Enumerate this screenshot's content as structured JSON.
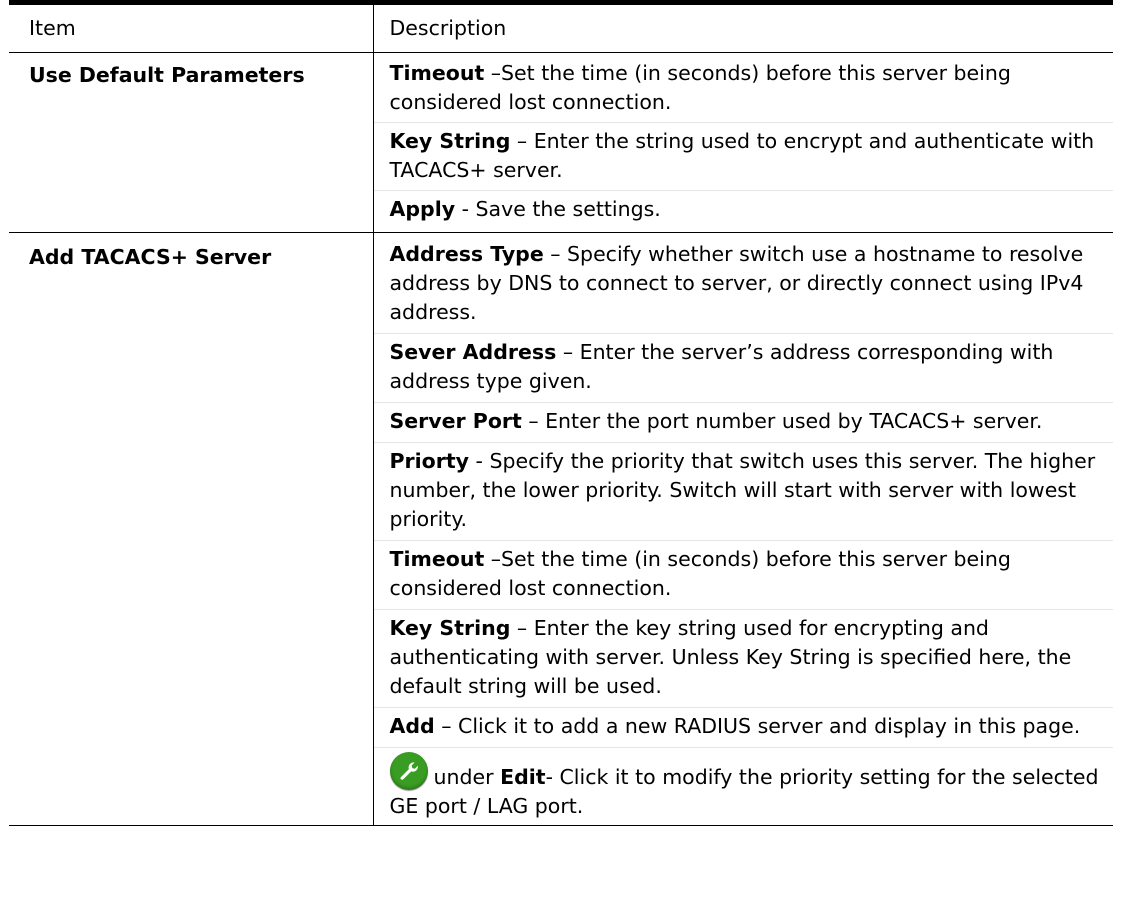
{
  "header": {
    "item": "Item",
    "description": "Description"
  },
  "rows": [
    {
      "item": "Use Default Parameters",
      "paras": [
        {
          "term": "Timeout",
          "text": " –Set the time (in seconds) before this server being considered lost connection."
        },
        {
          "term": "Key String",
          "text": " – Enter the string used to encrypt and authenticate with TACACS+ server."
        },
        {
          "term": "Apply",
          "text": " - Save the settings."
        }
      ]
    },
    {
      "item": "Add TACACS+ Server",
      "paras": [
        {
          "term": "Address Type",
          "text": " – Specify whether switch use a hostname to resolve address by DNS to connect to server, or directly connect using IPv4 address."
        },
        {
          "term": "Sever Address",
          "text": " – Enter the server’s address corresponding with address type given."
        },
        {
          "term": "Server Port",
          "text": " – Enter the port number used by TACACS+ server."
        },
        {
          "term": "Priorty",
          "text": " - Specify the priority that switch uses this server. The higher number, the lower priority. Switch will start with server with lowest priority."
        },
        {
          "term": "Timeout",
          "text": " –Set the time (in seconds) before this server being considered lost connection."
        },
        {
          "term": "Key String",
          "text": " – Enter the key string used for encrypting and authenticating with server. Unless Key String is specified here, the default string will be used."
        },
        {
          "term": "Add",
          "text": " – Click it to add a new RADIUS server and display in this page."
        }
      ],
      "edit": {
        "icon": "wrench-icon",
        "before": "under ",
        "term": "Edit",
        "text": "- Click it to modify the priority setting for the selected GE port / LAG port."
      }
    }
  ]
}
